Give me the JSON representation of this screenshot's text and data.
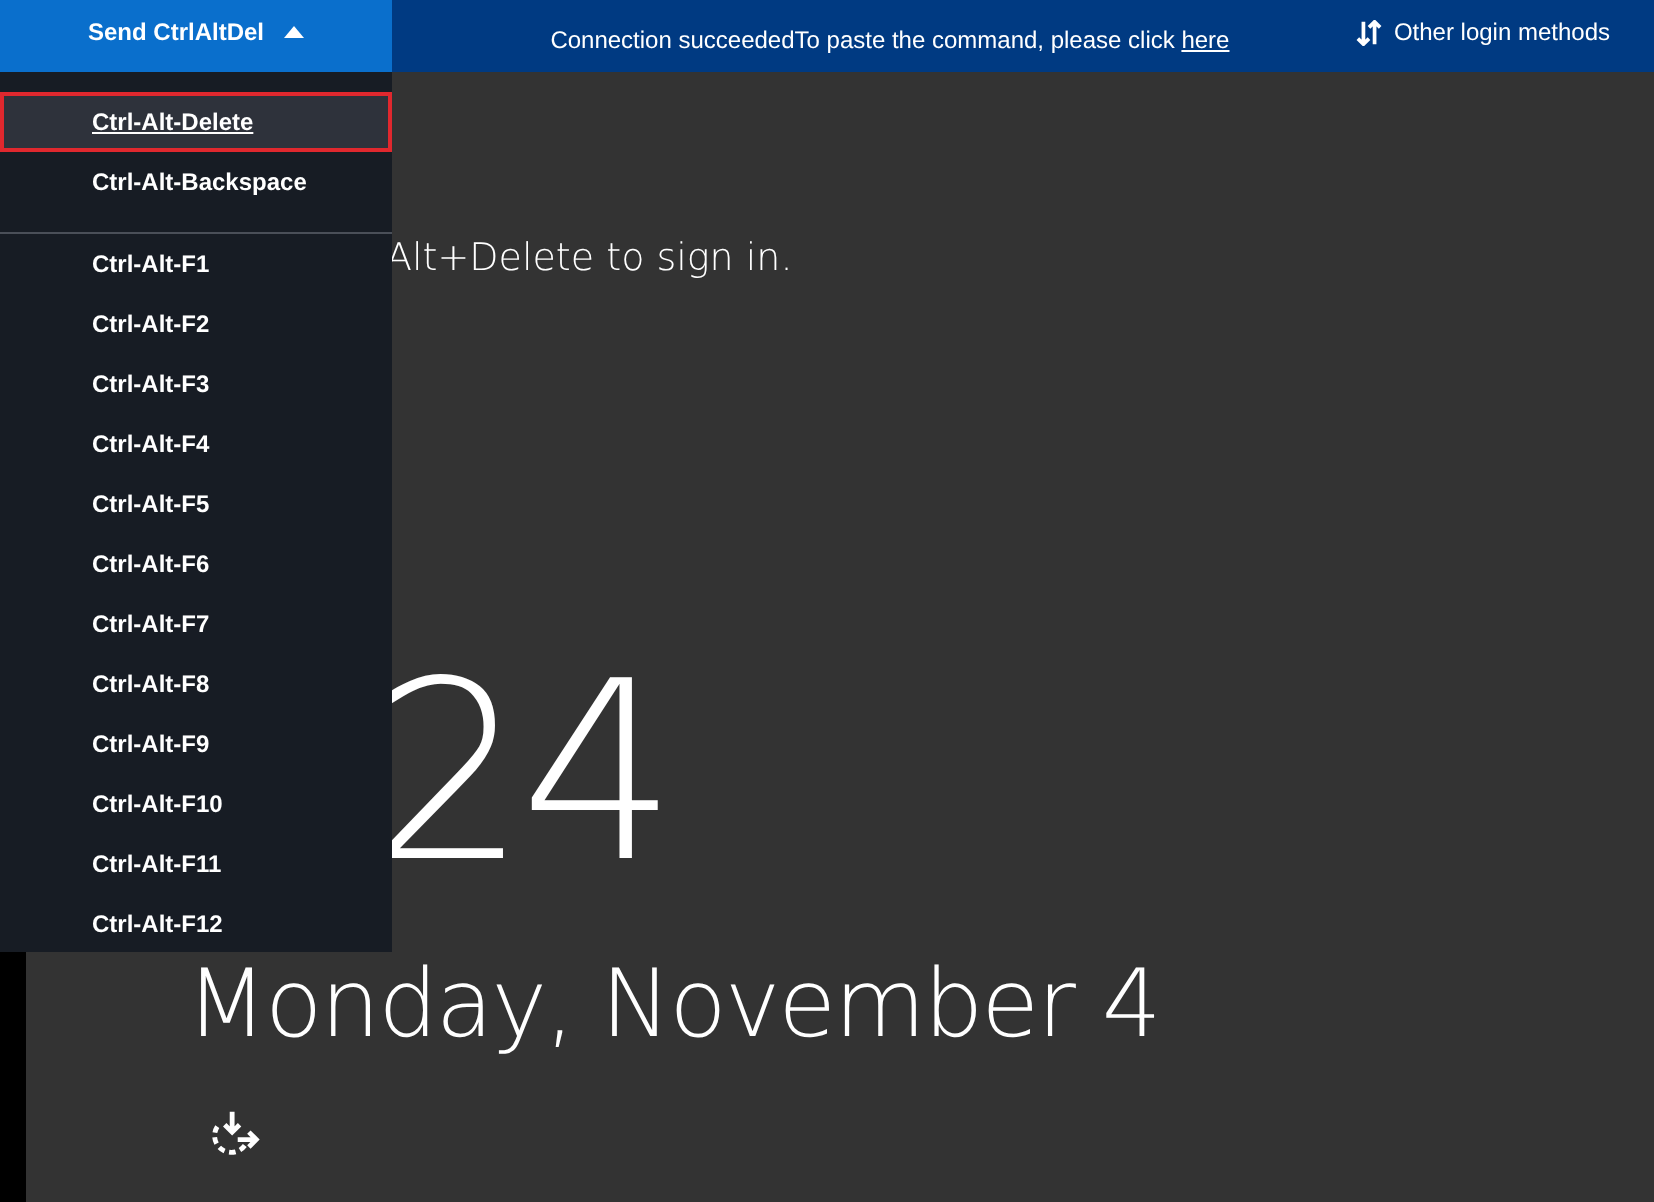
{
  "toolbar": {
    "send_button": {
      "label": "Send CtrlAltDel",
      "expanded": true
    },
    "notice": {
      "text": "Connection succeededTo paste the command, please click ",
      "link": "here"
    },
    "other_login": {
      "label": "Other login methods"
    }
  },
  "menu": {
    "groups": [
      [
        {
          "label": "Ctrl-Alt-Delete",
          "selected": true
        },
        {
          "label": "Ctrl-Alt-Backspace",
          "selected": false
        }
      ],
      [
        {
          "label": "Ctrl-Alt-F1",
          "selected": false
        },
        {
          "label": "Ctrl-Alt-F2",
          "selected": false
        },
        {
          "label": "Ctrl-Alt-F3",
          "selected": false
        },
        {
          "label": "Ctrl-Alt-F4",
          "selected": false
        },
        {
          "label": "Ctrl-Alt-F5",
          "selected": false
        },
        {
          "label": "Ctrl-Alt-F6",
          "selected": false
        },
        {
          "label": "Ctrl-Alt-F7",
          "selected": false
        },
        {
          "label": "Ctrl-Alt-F8",
          "selected": false
        },
        {
          "label": "Ctrl-Alt-F9",
          "selected": false
        },
        {
          "label": "Ctrl-Alt-F10",
          "selected": false
        },
        {
          "label": "Ctrl-Alt-F11",
          "selected": false
        },
        {
          "label": "Ctrl-Alt-F12",
          "selected": false
        }
      ]
    ]
  },
  "lock_screen": {
    "prompt": "Alt+Delete to sign in.",
    "clock": "24",
    "date": "Monday, November 4"
  }
}
